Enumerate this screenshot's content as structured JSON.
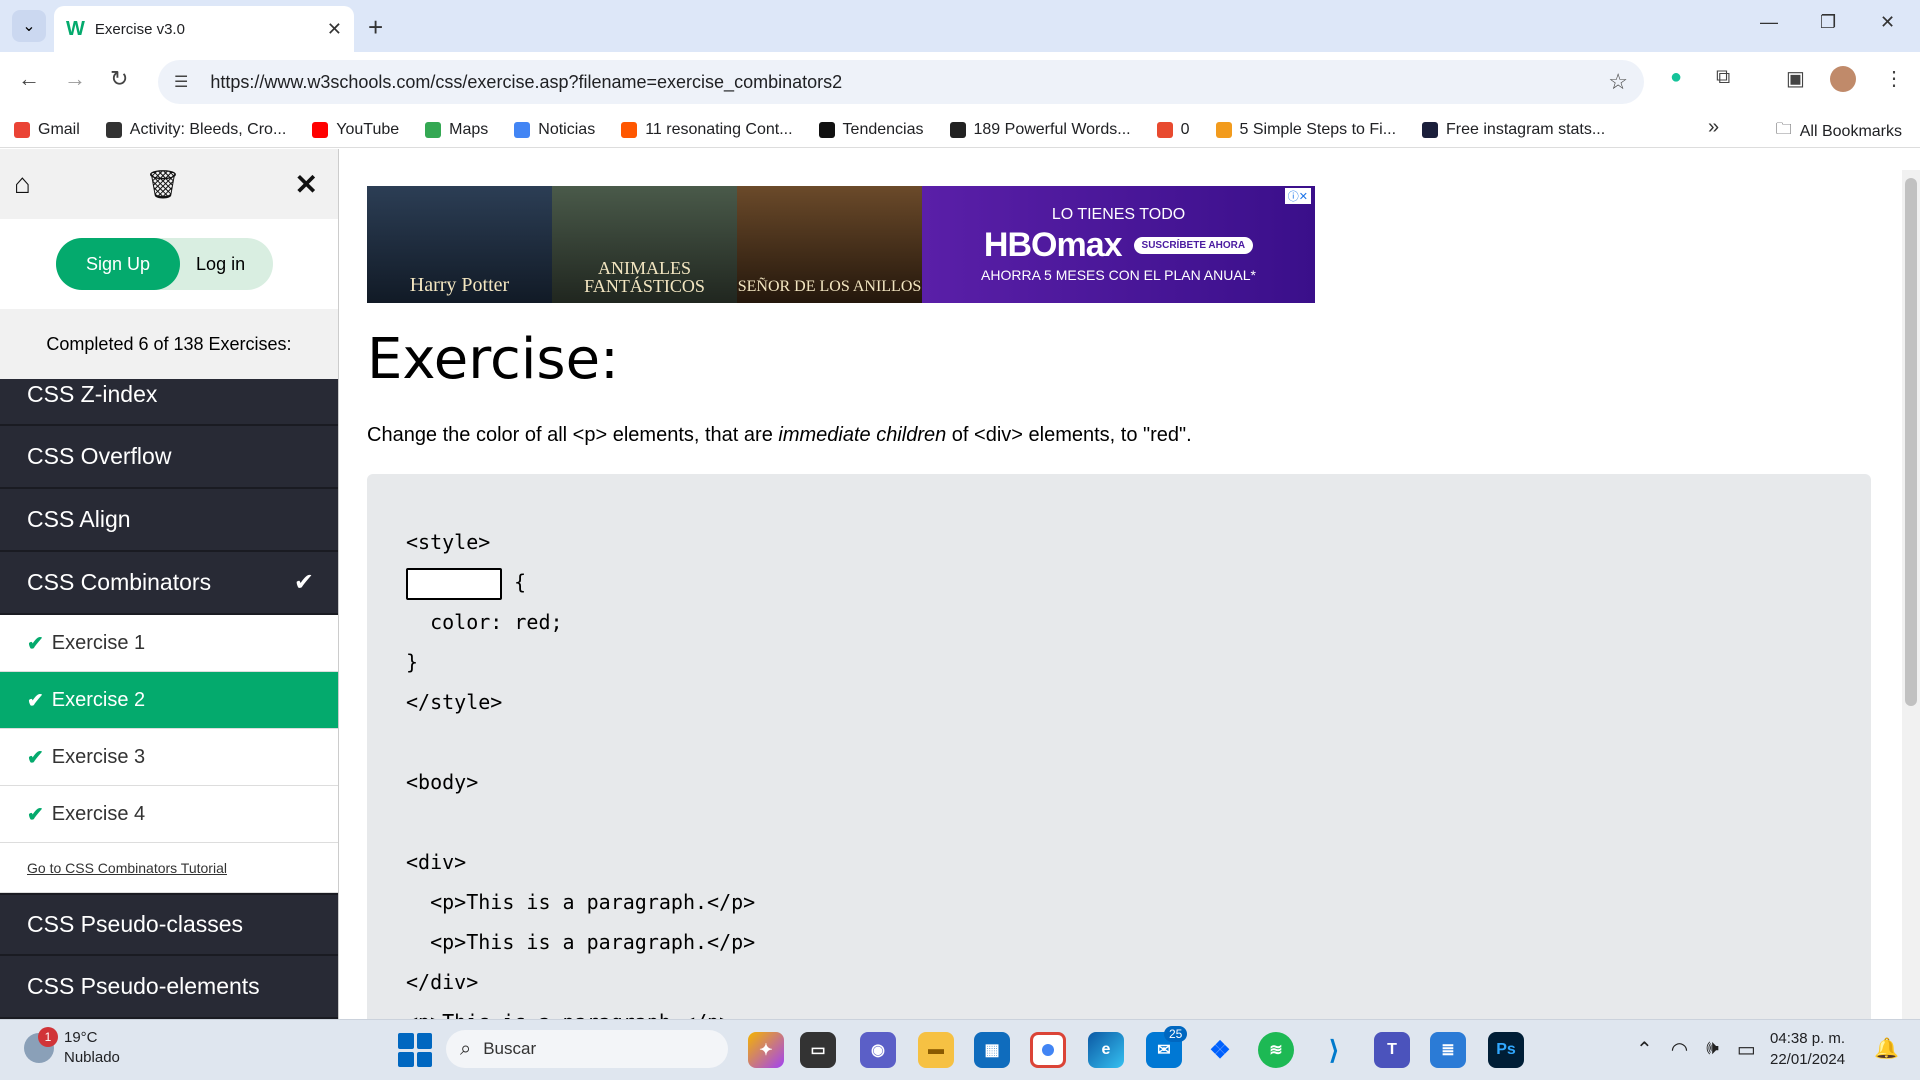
{
  "browser": {
    "tab_title": "Exercise v3.0",
    "url": "https://www.w3schools.com/css/exercise.asp?filename=exercise_combinators2",
    "bookmarks": [
      {
        "label": "Gmail",
        "color": "#ea4335",
        "icon": "gmail-icon"
      },
      {
        "label": "Activity: Bleeds, Cro...",
        "color": "#333333",
        "icon": "activity-icon"
      },
      {
        "label": "YouTube",
        "color": "#ff0000",
        "icon": "youtube-icon"
      },
      {
        "label": "Maps",
        "color": "#34a853",
        "icon": "maps-icon"
      },
      {
        "label": "Noticias",
        "color": "#4285f4",
        "icon": "news-icon"
      },
      {
        "label": "11 resonating Cont...",
        "color": "#ff5700",
        "icon": "reddit-icon"
      },
      {
        "label": "Tendencias",
        "color": "#111111",
        "icon": "trends-icon"
      },
      {
        "label": "189 Powerful Words...",
        "color": "#222222",
        "icon": "layers-icon"
      },
      {
        "label": "0",
        "color": "#e84a2f",
        "icon": "diamond-icon"
      },
      {
        "label": "5 Simple Steps to Fi...",
        "color": "#f29b1d",
        "icon": "steps-icon"
      },
      {
        "label": "Free instagram stats...",
        "color": "#1b1f3b",
        "icon": "instagram-stats-icon"
      }
    ],
    "all_bookmarks": "All Bookmarks"
  },
  "sidebar": {
    "signup": "Sign Up",
    "login": "Log in",
    "completed": "Completed 6 of 138 Exercises:",
    "topics_above": [
      "CSS Z-index",
      "CSS Overflow",
      "CSS Align"
    ],
    "current_topic": "CSS Combinators",
    "exercises": [
      {
        "label": "Exercise 1",
        "active": false
      },
      {
        "label": "Exercise 2",
        "active": true
      },
      {
        "label": "Exercise 3",
        "active": false
      },
      {
        "label": "Exercise 4",
        "active": false
      }
    ],
    "tutorial_link": "Go to CSS Combinators Tutorial",
    "topics_below": [
      "CSS Pseudo-classes",
      "CSS Pseudo-elements"
    ]
  },
  "ad": {
    "posters": [
      "Harry Potter",
      "ANIMALES FANTÁSTICOS",
      "SEÑOR DE LOS ANILLOS"
    ],
    "line1": "LO TIENES TODO",
    "brand": "HBOmax",
    "cta": "SUSCRÍBETE AHORA",
    "line3": "AHORRA 5 MESES CON EL PLAN ANUAL*"
  },
  "exercise": {
    "title": "Exercise:",
    "desc_before": "Change the color of all <p> elements, that are ",
    "desc_em": "immediate children",
    "desc_after": " of <div> elements, to \"red\".",
    "code": {
      "l1": "<style>",
      "l2_after": " {",
      "l3": "  color: red;",
      "l4": "}",
      "l5": "</style>",
      "l6": "",
      "l7": "<body>",
      "l8": "",
      "l9": "<div>",
      "l10": "  <p>This is a paragraph.</p>",
      "l11": "  <p>This is a paragraph.</p>",
      "l12": "</div>",
      "l13": "<p>This is a paragraph.</p>"
    }
  },
  "taskbar": {
    "weather_temp": "19°C",
    "weather_desc": "Nublado",
    "weather_badge": "1",
    "search": "Buscar",
    "mail_badge": "25",
    "time": "04:38 p. m.",
    "date": "22/01/2024"
  },
  "colors": {
    "accent": "#04aa6d",
    "sidebar_dark": "#282a35",
    "code_bg": "#e7e9eb"
  }
}
